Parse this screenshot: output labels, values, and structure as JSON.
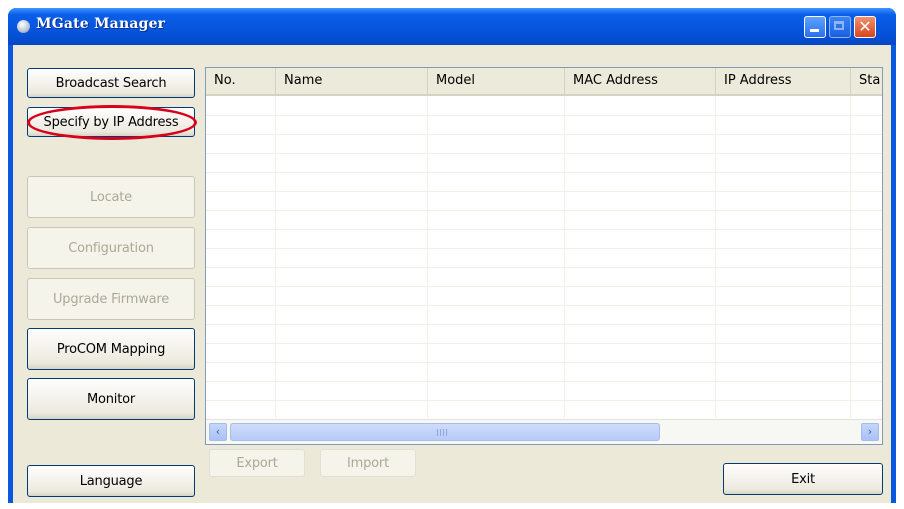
{
  "window": {
    "title": "MGate Manager",
    "controls": {
      "minimize": "minimize",
      "maximize": "maximize",
      "close": "✕"
    }
  },
  "left_panel": {
    "broadcast_search": "Broadcast Search",
    "specify_by_ip": "Specify by IP Address",
    "locate": "Locate",
    "configuration": "Configuration",
    "upgrade_firmware": "Upgrade Firmware",
    "procom_mapping": "ProCOM Mapping",
    "monitor": "Monitor",
    "language": "Language"
  },
  "table": {
    "columns": [
      "No.",
      "Name",
      "Model",
      "MAC Address",
      "IP Address",
      "Sta"
    ],
    "rows": []
  },
  "scrollbar": {
    "left_arrow": "‹",
    "right_arrow": "›"
  },
  "bottom": {
    "export": "Export",
    "import": "Import",
    "exit": "Exit"
  },
  "colors": {
    "title_bar": "#0a5ee8",
    "face": "#ece9d8",
    "highlight_ring": "#d9001c"
  }
}
